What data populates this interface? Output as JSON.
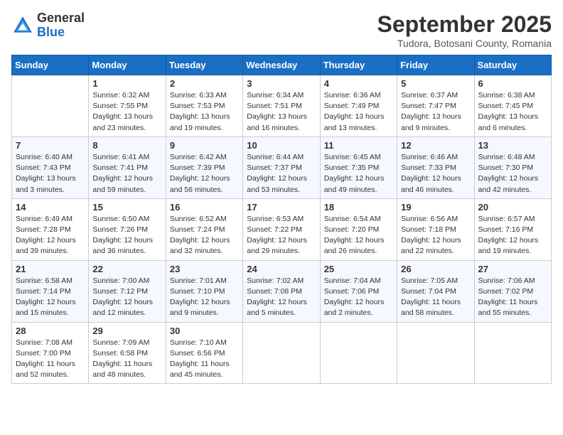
{
  "header": {
    "logo_general": "General",
    "logo_blue": "Blue",
    "month_title": "September 2025",
    "subtitle": "Tudora, Botosani County, Romania"
  },
  "days_of_week": [
    "Sunday",
    "Monday",
    "Tuesday",
    "Wednesday",
    "Thursday",
    "Friday",
    "Saturday"
  ],
  "weeks": [
    [
      {
        "day": "",
        "info": ""
      },
      {
        "day": "1",
        "info": "Sunrise: 6:32 AM\nSunset: 7:55 PM\nDaylight: 13 hours\nand 23 minutes."
      },
      {
        "day": "2",
        "info": "Sunrise: 6:33 AM\nSunset: 7:53 PM\nDaylight: 13 hours\nand 19 minutes."
      },
      {
        "day": "3",
        "info": "Sunrise: 6:34 AM\nSunset: 7:51 PM\nDaylight: 13 hours\nand 16 minutes."
      },
      {
        "day": "4",
        "info": "Sunrise: 6:36 AM\nSunset: 7:49 PM\nDaylight: 13 hours\nand 13 minutes."
      },
      {
        "day": "5",
        "info": "Sunrise: 6:37 AM\nSunset: 7:47 PM\nDaylight: 13 hours\nand 9 minutes."
      },
      {
        "day": "6",
        "info": "Sunrise: 6:38 AM\nSunset: 7:45 PM\nDaylight: 13 hours\nand 6 minutes."
      }
    ],
    [
      {
        "day": "7",
        "info": "Sunrise: 6:40 AM\nSunset: 7:43 PM\nDaylight: 13 hours\nand 3 minutes."
      },
      {
        "day": "8",
        "info": "Sunrise: 6:41 AM\nSunset: 7:41 PM\nDaylight: 12 hours\nand 59 minutes."
      },
      {
        "day": "9",
        "info": "Sunrise: 6:42 AM\nSunset: 7:39 PM\nDaylight: 12 hours\nand 56 minutes."
      },
      {
        "day": "10",
        "info": "Sunrise: 6:44 AM\nSunset: 7:37 PM\nDaylight: 12 hours\nand 53 minutes."
      },
      {
        "day": "11",
        "info": "Sunrise: 6:45 AM\nSunset: 7:35 PM\nDaylight: 12 hours\nand 49 minutes."
      },
      {
        "day": "12",
        "info": "Sunrise: 6:46 AM\nSunset: 7:33 PM\nDaylight: 12 hours\nand 46 minutes."
      },
      {
        "day": "13",
        "info": "Sunrise: 6:48 AM\nSunset: 7:30 PM\nDaylight: 12 hours\nand 42 minutes."
      }
    ],
    [
      {
        "day": "14",
        "info": "Sunrise: 6:49 AM\nSunset: 7:28 PM\nDaylight: 12 hours\nand 39 minutes."
      },
      {
        "day": "15",
        "info": "Sunrise: 6:50 AM\nSunset: 7:26 PM\nDaylight: 12 hours\nand 36 minutes."
      },
      {
        "day": "16",
        "info": "Sunrise: 6:52 AM\nSunset: 7:24 PM\nDaylight: 12 hours\nand 32 minutes."
      },
      {
        "day": "17",
        "info": "Sunrise: 6:53 AM\nSunset: 7:22 PM\nDaylight: 12 hours\nand 29 minutes."
      },
      {
        "day": "18",
        "info": "Sunrise: 6:54 AM\nSunset: 7:20 PM\nDaylight: 12 hours\nand 26 minutes."
      },
      {
        "day": "19",
        "info": "Sunrise: 6:56 AM\nSunset: 7:18 PM\nDaylight: 12 hours\nand 22 minutes."
      },
      {
        "day": "20",
        "info": "Sunrise: 6:57 AM\nSunset: 7:16 PM\nDaylight: 12 hours\nand 19 minutes."
      }
    ],
    [
      {
        "day": "21",
        "info": "Sunrise: 6:58 AM\nSunset: 7:14 PM\nDaylight: 12 hours\nand 15 minutes."
      },
      {
        "day": "22",
        "info": "Sunrise: 7:00 AM\nSunset: 7:12 PM\nDaylight: 12 hours\nand 12 minutes."
      },
      {
        "day": "23",
        "info": "Sunrise: 7:01 AM\nSunset: 7:10 PM\nDaylight: 12 hours\nand 9 minutes."
      },
      {
        "day": "24",
        "info": "Sunrise: 7:02 AM\nSunset: 7:08 PM\nDaylight: 12 hours\nand 5 minutes."
      },
      {
        "day": "25",
        "info": "Sunrise: 7:04 AM\nSunset: 7:06 PM\nDaylight: 12 hours\nand 2 minutes."
      },
      {
        "day": "26",
        "info": "Sunrise: 7:05 AM\nSunset: 7:04 PM\nDaylight: 11 hours\nand 58 minutes."
      },
      {
        "day": "27",
        "info": "Sunrise: 7:06 AM\nSunset: 7:02 PM\nDaylight: 11 hours\nand 55 minutes."
      }
    ],
    [
      {
        "day": "28",
        "info": "Sunrise: 7:08 AM\nSunset: 7:00 PM\nDaylight: 11 hours\nand 52 minutes."
      },
      {
        "day": "29",
        "info": "Sunrise: 7:09 AM\nSunset: 6:58 PM\nDaylight: 11 hours\nand 48 minutes."
      },
      {
        "day": "30",
        "info": "Sunrise: 7:10 AM\nSunset: 6:56 PM\nDaylight: 11 hours\nand 45 minutes."
      },
      {
        "day": "",
        "info": ""
      },
      {
        "day": "",
        "info": ""
      },
      {
        "day": "",
        "info": ""
      },
      {
        "day": "",
        "info": ""
      }
    ]
  ]
}
